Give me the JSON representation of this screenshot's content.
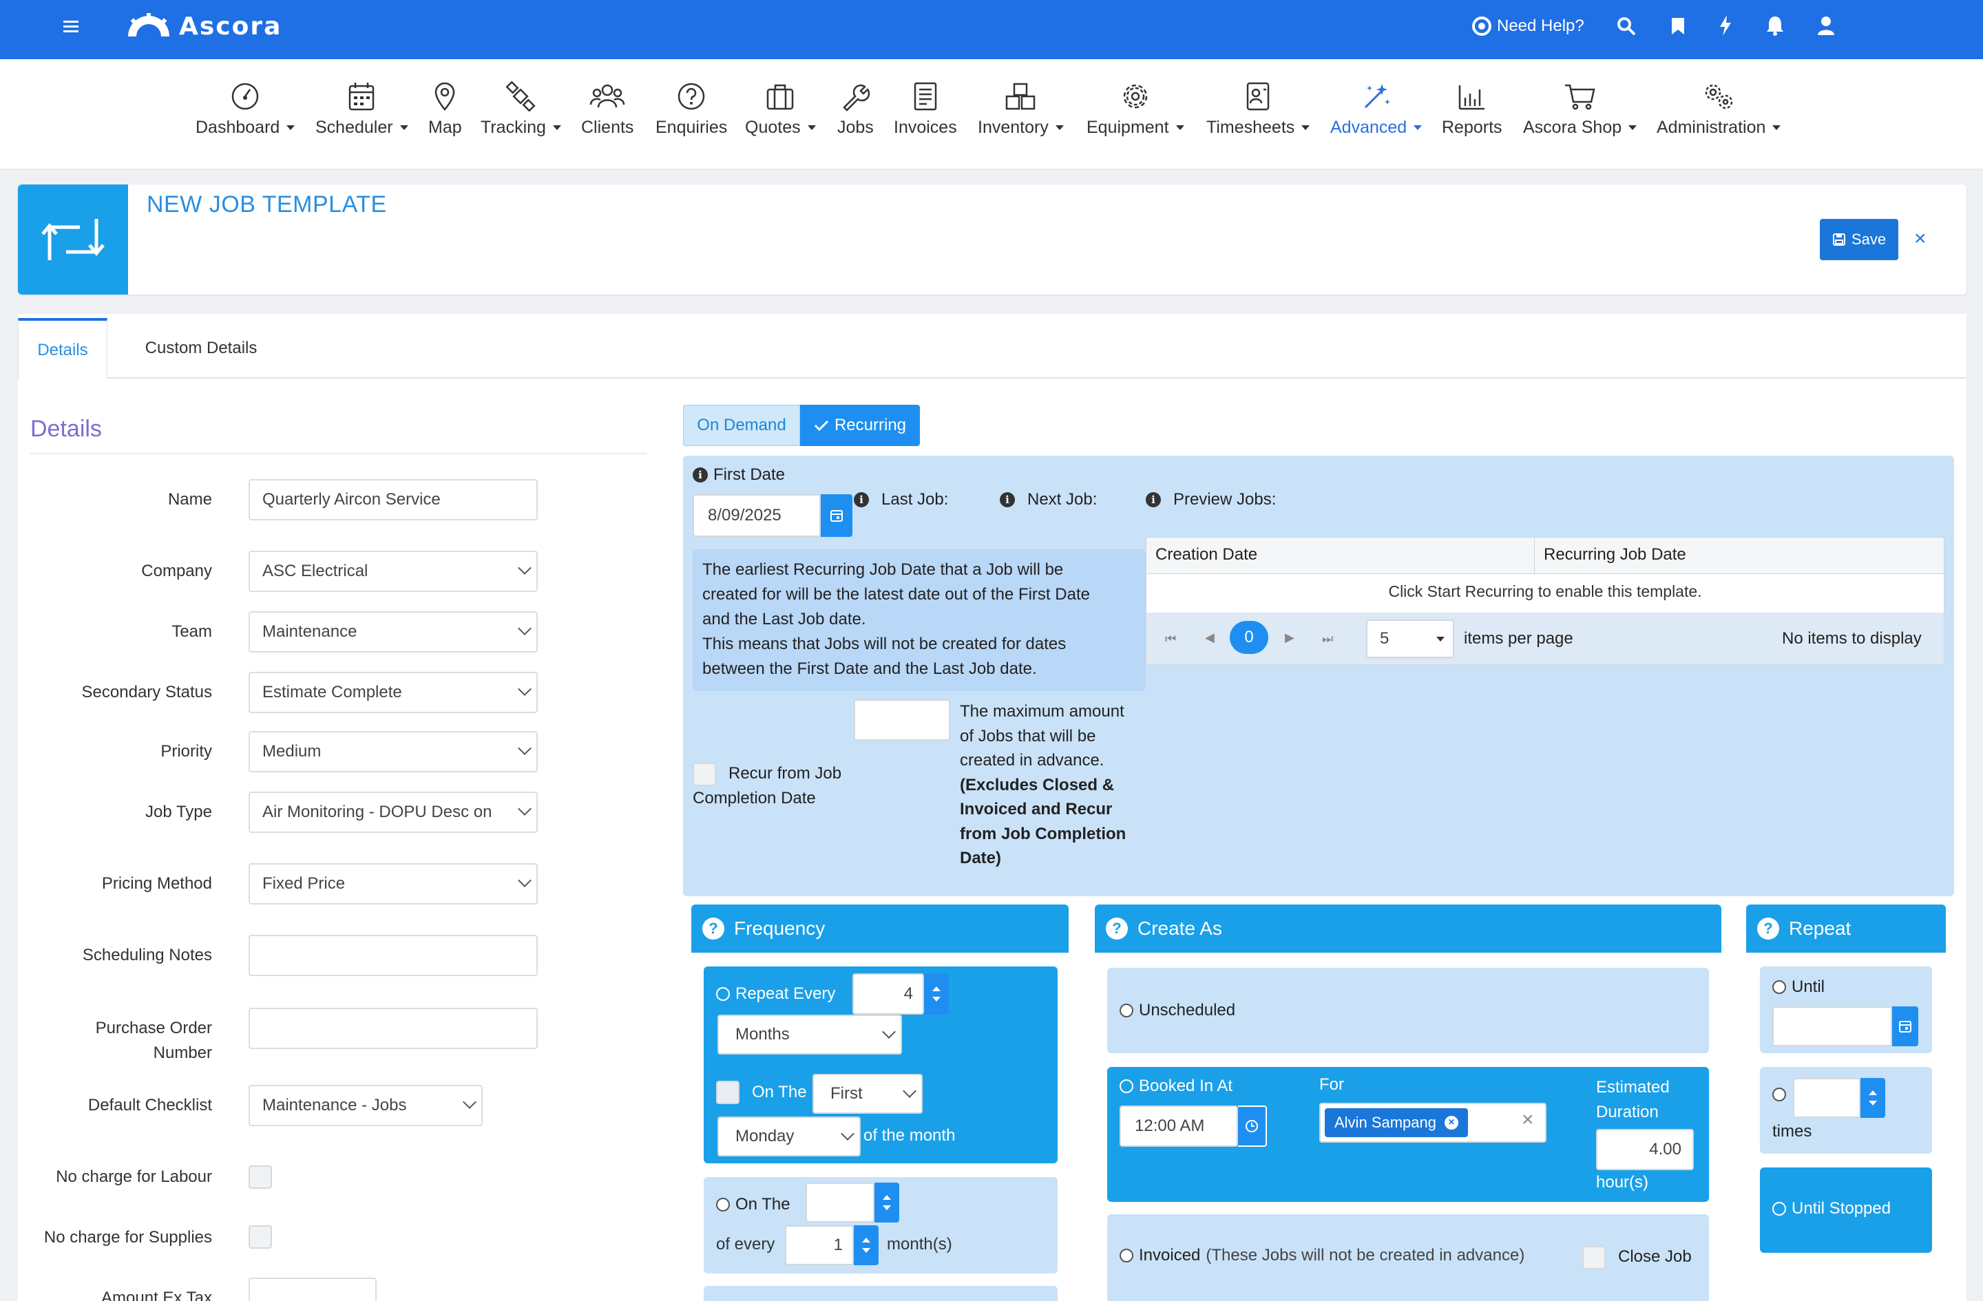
{
  "app": {
    "brand": "Ascora",
    "need_help": "Need Help?"
  },
  "nav": {
    "dashboard": "Dashboard",
    "scheduler": "Scheduler",
    "map": "Map",
    "tracking": "Tracking",
    "clients": "Clients",
    "enquiries": "Enquiries",
    "quotes": "Quotes",
    "jobs": "Jobs",
    "invoices": "Invoices",
    "inventory": "Inventory",
    "equipment": "Equipment",
    "timesheets": "Timesheets",
    "advanced": "Advanced",
    "reports": "Reports",
    "shop": "Ascora Shop",
    "administration": "Administration"
  },
  "header": {
    "title": "NEW JOB TEMPLATE",
    "save": "Save",
    "close": "×"
  },
  "tabs": {
    "details": "Details",
    "custom": "Custom Details"
  },
  "details": {
    "heading": "Details",
    "labels": {
      "name": "Name",
      "company": "Company",
      "team": "Team",
      "secondary_status": "Secondary Status",
      "priority": "Priority",
      "job_type": "Job Type",
      "pricing_method": "Pricing Method",
      "scheduling_notes": "Scheduling Notes",
      "purchase_order_line1": "Purchase Order",
      "purchase_order_line2": "Number",
      "default_checklist": "Default Checklist",
      "no_charge_labour": "No charge for Labour",
      "no_charge_supplies": "No charge for Supplies",
      "amount_ex_tax": "Amount Ex Tax"
    },
    "values": {
      "name": "Quarterly Aircon Service",
      "company": "ASC Electrical",
      "team": "Maintenance",
      "secondary_status": "Estimate Complete",
      "priority": "Medium",
      "job_type": "Air Monitoring - DOPU Desc on",
      "pricing_method": "Fixed Price",
      "scheduling_notes": "",
      "purchase_order": "",
      "default_checklist": "Maintenance - Jobs",
      "amount_ex_tax": ""
    }
  },
  "recurrence": {
    "on_demand": "On Demand",
    "recurring": "Recurring",
    "first_date_label": "First Date",
    "first_date": "8/09/2025",
    "last_job": "Last Job:",
    "next_job": "Next Job:",
    "preview_jobs": "Preview Jobs:",
    "info_lines": [
      "The earliest Recurring Job Date that a Job will be",
      "created for will be the latest date out of the First Date",
      "and the Last Job date.",
      "This means that Jobs will not be created for dates",
      "between the First Date and the Last Job date."
    ],
    "table": {
      "col1": "Creation Date",
      "col2": "Recurring Job Date",
      "empty_msg": "Click Start Recurring to enable this template.",
      "page": "0",
      "page_size": "5",
      "per_page": "items per page",
      "no_items": "No items to display"
    },
    "max_jobs_value": "",
    "max_jobs_lines": [
      "The maximum amount",
      "of Jobs that will be",
      "created in advance."
    ],
    "max_jobs_bold_lines": [
      "(Excludes Closed &",
      "Invoiced and Recur",
      "from Job Completion",
      "Date)"
    ],
    "recur_from_line1": "Recur from Job",
    "recur_from_line2": "Completion Date"
  },
  "frequency": {
    "title": "Frequency",
    "repeat_every": "Repeat Every",
    "repeat_value": "4",
    "unit": "Months",
    "on_the": "On The",
    "first": "First",
    "weekday": "Monday",
    "of_the_month": "of the month",
    "on_the_2": "On The",
    "day_value": "",
    "of_every": "of every",
    "every_value": "1",
    "months_suffix": "month(s)"
  },
  "create_as": {
    "title": "Create As",
    "unscheduled": "Unscheduled",
    "booked_in_at": "Booked In At",
    "time": "12:00 AM",
    "for": "For",
    "assignee": "Alvin Sampang",
    "estimated_line1": "Estimated",
    "estimated_line2": "Duration",
    "duration": "4.00",
    "hours": "hour(s)",
    "invoiced": "Invoiced",
    "invoiced_note": "(These Jobs will not be created in advance)",
    "close_job": "Close Job"
  },
  "repeat": {
    "title": "Repeat",
    "until": "Until",
    "until_value": "",
    "times_value": "",
    "times": "times",
    "until_stopped": "Until Stopped"
  },
  "colors": {
    "primary": "#1f6fe5",
    "accent": "#1aa0e8",
    "panel": "#c9e2f8"
  }
}
